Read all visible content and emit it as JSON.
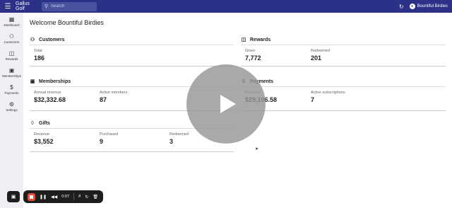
{
  "topbar": {
    "app_title": "Gallus Golf",
    "search_placeholder": "Search",
    "user_name": "Bountiful Birdies",
    "bg_color": "#2a3186"
  },
  "sidebar": {
    "items": [
      {
        "label": "Dashboard",
        "icon": "grid-icon"
      },
      {
        "label": "Customers",
        "icon": "people-icon"
      },
      {
        "label": "Rewards",
        "icon": "gift-box-icon"
      },
      {
        "label": "Memberships",
        "icon": "badge-icon"
      },
      {
        "label": "Payments",
        "icon": "dollar-icon"
      },
      {
        "label": "Settings",
        "icon": "gear-icon"
      }
    ]
  },
  "main": {
    "welcome": "Welcome Bountiful Birdies",
    "cards": {
      "customers": {
        "title": "Customers",
        "stats": [
          {
            "label": "Total",
            "value": "186"
          }
        ]
      },
      "rewards": {
        "title": "Rewards",
        "stats": [
          {
            "label": "Given",
            "value": "7,772"
          },
          {
            "label": "Redeemed",
            "value": "201"
          }
        ]
      },
      "memberships": {
        "title": "Memberships",
        "stats": [
          {
            "label": "Annual revenue",
            "value": "$32,332.68"
          },
          {
            "label": "Active members",
            "value": "87"
          }
        ]
      },
      "payments": {
        "title": "Payments",
        "stats": [
          {
            "label": "Revenue",
            "value": "$29,106.58"
          },
          {
            "label": "Active subscriptions",
            "value": "7"
          }
        ]
      },
      "gifts": {
        "title": "Gifts",
        "stats": [
          {
            "label": "Revenue",
            "value": "$3,552"
          },
          {
            "label": "Purchased",
            "value": "9"
          },
          {
            "label": "Redeemed",
            "value": "3"
          }
        ]
      }
    }
  },
  "recorder": {
    "time": "0:07",
    "stop_color": "#e74c3c"
  }
}
